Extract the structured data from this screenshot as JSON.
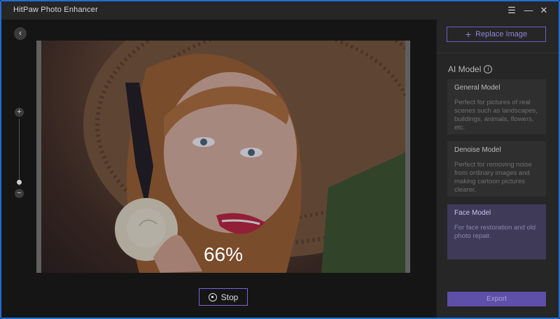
{
  "window": {
    "title": "HitPaw Photo Enhancer",
    "menu_glyph": "☰",
    "minimize_glyph": "—",
    "close_glyph": "✕"
  },
  "main": {
    "back_glyph": "‹",
    "zoom": {
      "plus_glyph": "+",
      "minus_glyph": "−"
    },
    "progress_text": "66%",
    "stop_label": "Stop"
  },
  "sidebar": {
    "replace_label": "Replace Image",
    "plus_glyph": "+",
    "ai_model_title": "AI Model",
    "info_glyph": "i",
    "models": [
      {
        "name": "General Model",
        "desc": "Perfect for pictures of real scenes such as landscapes, buildings, animals, flowers, etc."
      },
      {
        "name": "Denoise Model",
        "desc": "Perfect for removing noise from ordinary images and making cartoon pictures clearer."
      },
      {
        "name": "Face Model",
        "desc": "For face restoration and old photo repair."
      }
    ],
    "export_label": "Export"
  },
  "colors": {
    "accent": "#6b5dc4",
    "border": "#1f6fd1"
  }
}
